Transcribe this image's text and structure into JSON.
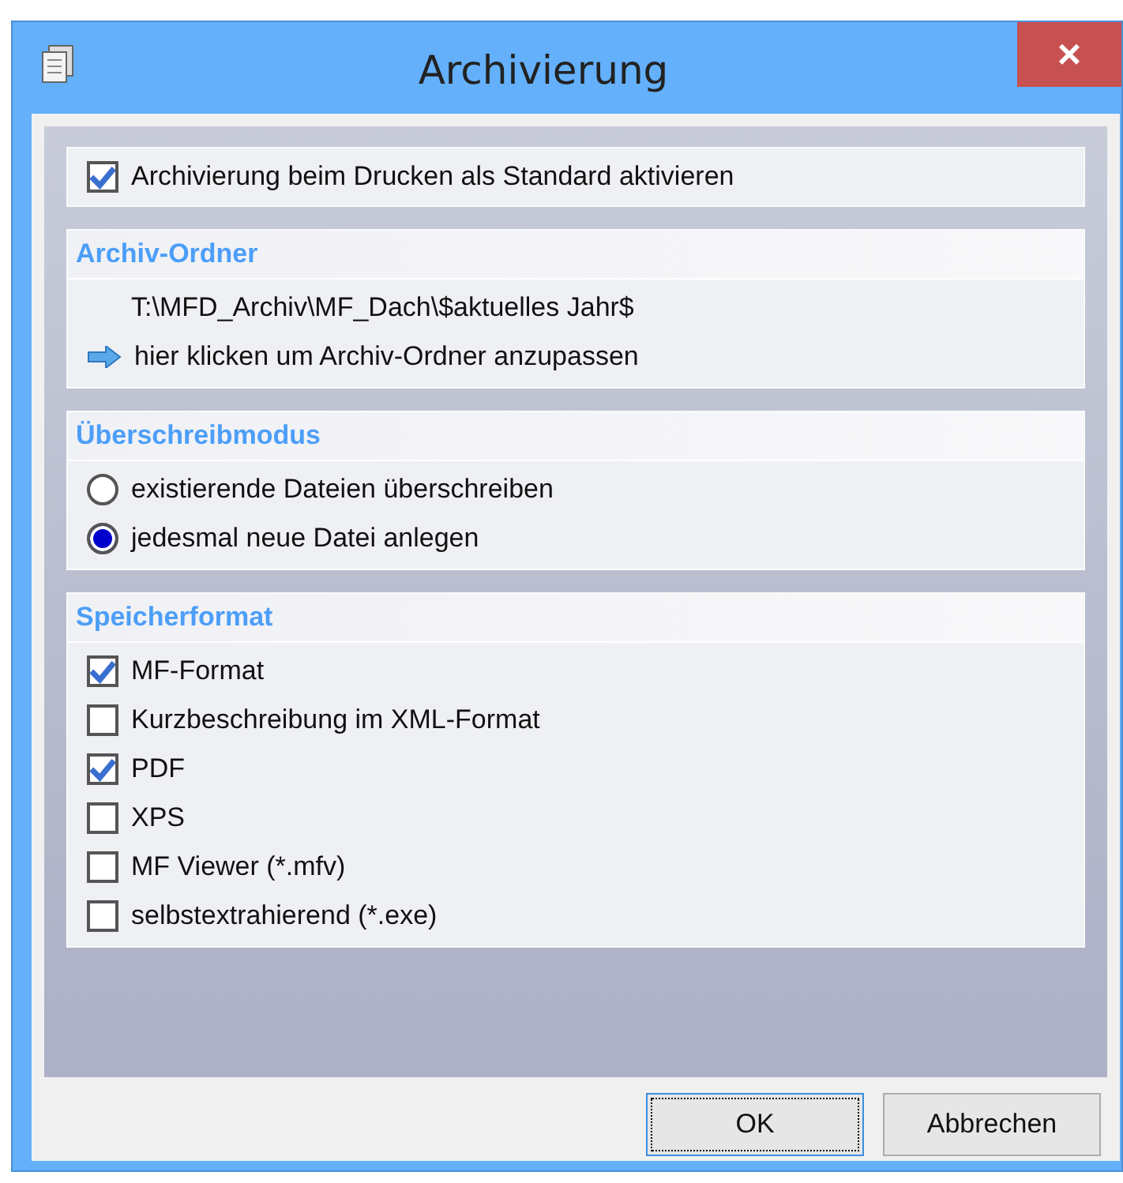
{
  "window": {
    "title": "Archivierung",
    "close": "×"
  },
  "default_option": {
    "label": "Archivierung beim Drucken als Standard aktivieren",
    "checked": true
  },
  "archive_folder": {
    "heading": "Archiv-Ordner",
    "path": "T:\\MFD_Archiv\\MF_Dach\\$aktuelles Jahr$",
    "link": "hier klicken um Archiv-Ordner anzupassen"
  },
  "overwrite_mode": {
    "heading": "Überschreibmodus",
    "options": [
      {
        "label": "existierende Dateien überschreiben",
        "selected": false
      },
      {
        "label": "jedesmal neue Datei anlegen",
        "selected": true
      }
    ]
  },
  "save_format": {
    "heading": "Speicherformat",
    "options": [
      {
        "label": "MF-Format",
        "checked": true
      },
      {
        "label": "Kurzbeschreibung im XML-Format",
        "checked": false
      },
      {
        "label": "PDF",
        "checked": true
      },
      {
        "label": "XPS",
        "checked": false
      },
      {
        "label": "MF Viewer (*.mfv)",
        "checked": false
      },
      {
        "label": "selbstextrahierend (*.exe)",
        "checked": false
      }
    ]
  },
  "buttons": [
    {
      "label": "OK",
      "focused": true
    },
    {
      "label": "Abbrechen",
      "focused": false
    }
  ]
}
